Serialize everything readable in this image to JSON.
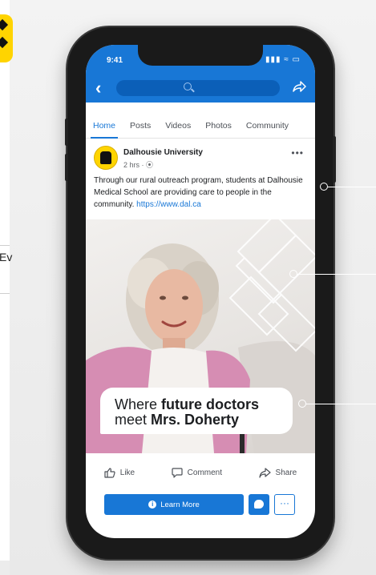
{
  "left_page": {
    "edge_text": "Ev"
  },
  "statusbar": {
    "time": "9:41",
    "icons": "▮▮▮ ≈ ▭"
  },
  "tabs": [
    "Home",
    "Posts",
    "Videos",
    "Photos",
    "Community"
  ],
  "post": {
    "author": "Dalhousie University",
    "meta": "2 hrs · ⦿",
    "text": "Through our rural outreach program, students at Dalhousie Medical School are providing care to people in the community. ",
    "link": "https://www.dal.ca",
    "caption_line1_regular": "Where ",
    "caption_line1_bold": "future doctors",
    "caption_line2_regular": "meet ",
    "caption_line2_bold": "Mrs. Doherty"
  },
  "actions": {
    "like": "Like",
    "comment": "Comment",
    "share": "Share"
  },
  "cta": {
    "label": "Learn More",
    "more": "···"
  },
  "colors": {
    "brand_blue": "#1877d6",
    "yellow": "#ffd400"
  }
}
